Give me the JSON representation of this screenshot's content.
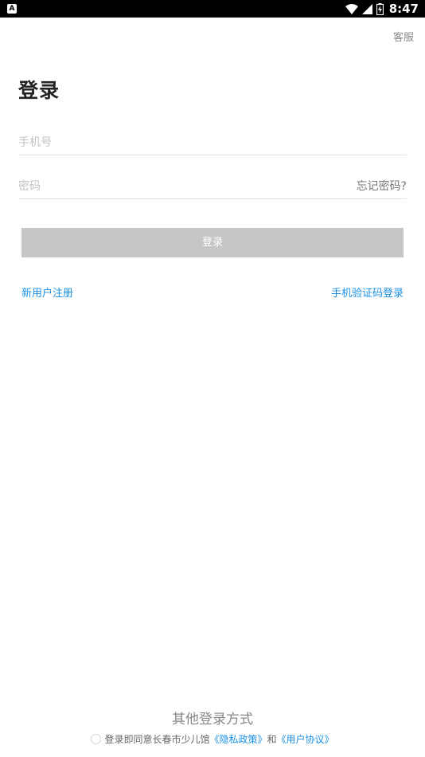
{
  "status_bar": {
    "left_icon": "A",
    "time": "8:47",
    "icons": [
      "wifi-icon",
      "signal-icon",
      "battery-charging-icon"
    ]
  },
  "header": {
    "service_label": "客服"
  },
  "title": "登录",
  "form": {
    "phone_placeholder": "手机号",
    "password_placeholder": "密码",
    "forgot_label": "忘记密码?",
    "login_label": "登录"
  },
  "links": {
    "register_label": "新用户注册",
    "sms_login_label": "手机验证码登录"
  },
  "footer": {
    "other_login_label": "其他登录方式",
    "agreement_prefix": "登录即同意长春市少儿馆",
    "privacy_label": "《隐私政策》",
    "and_label": "和",
    "user_agreement_label": "《用户协议》"
  },
  "colors": {
    "accent": "#1a90e6",
    "button_disabled": "#c6c6c6",
    "divider": "#e2e2e2"
  }
}
